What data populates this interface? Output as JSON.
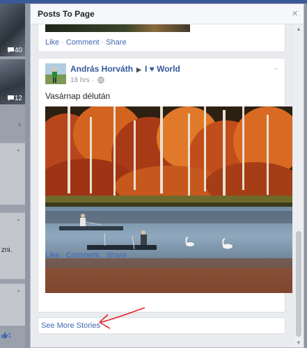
{
  "background_page": {
    "thumb_counts": [
      "40",
      "12"
    ],
    "side_text": [
      "zni."
    ],
    "like_count": "1"
  },
  "dialog": {
    "title": "Posts To Page",
    "close_icon": "close-icon"
  },
  "first_post": {
    "actions": {
      "like": "Like",
      "comment": "Comment",
      "share": "Share",
      "separator": "·"
    }
  },
  "post": {
    "author": "András Horváth",
    "arrow": "▶",
    "page": "I ♥ World",
    "time": "18 hrs",
    "separator": "·",
    "privacy_icon": "globe-icon",
    "text": "Vasárnap délután",
    "photo_subject": "autumn-lake-fishermen-swans",
    "actions": {
      "like": "Like",
      "comment": "Comment",
      "share": "Share",
      "separator": "·"
    }
  },
  "see_more": "See More Stories",
  "colors": {
    "link_blue": "#4267b2",
    "name_blue": "#365899",
    "annotation_red": "#e4232b",
    "fb_header": "#3b5998"
  }
}
